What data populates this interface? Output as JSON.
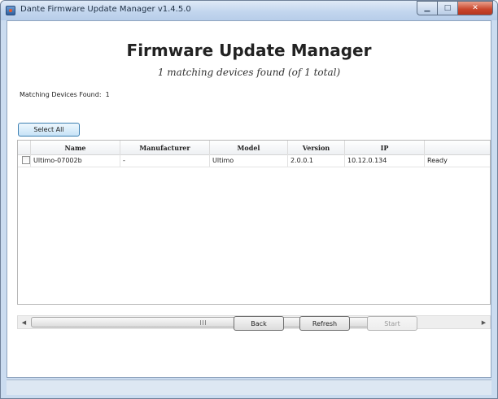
{
  "window": {
    "title": "Dante Firmware Update Manager v1.4.5.0"
  },
  "header": {
    "title": "Firmware Update Manager",
    "subtitle": "1 matching devices found (of 1 total)"
  },
  "matching": {
    "label": "Matching Devices Found:",
    "count": "1"
  },
  "toolbar": {
    "select_all": "Select All"
  },
  "table": {
    "columns": [
      "",
      "Name",
      "Manufacturer",
      "Model",
      "Version",
      "IP",
      ""
    ],
    "rows": [
      {
        "name": "Ultimo-07002b",
        "manufacturer": "-",
        "model": "Ultimo",
        "version": "2.0.0.1",
        "ip": "10.12.0.134",
        "status": "Ready"
      }
    ]
  },
  "buttons": {
    "back": "Back",
    "refresh": "Refresh",
    "start": "Start"
  },
  "icons": {
    "app": "dante-app-icon",
    "minimize": "minimize-icon",
    "maximize": "maximize-icon",
    "close": "close-icon",
    "scroll_left": "arrow-left-icon",
    "scroll_right": "arrow-right-icon"
  }
}
